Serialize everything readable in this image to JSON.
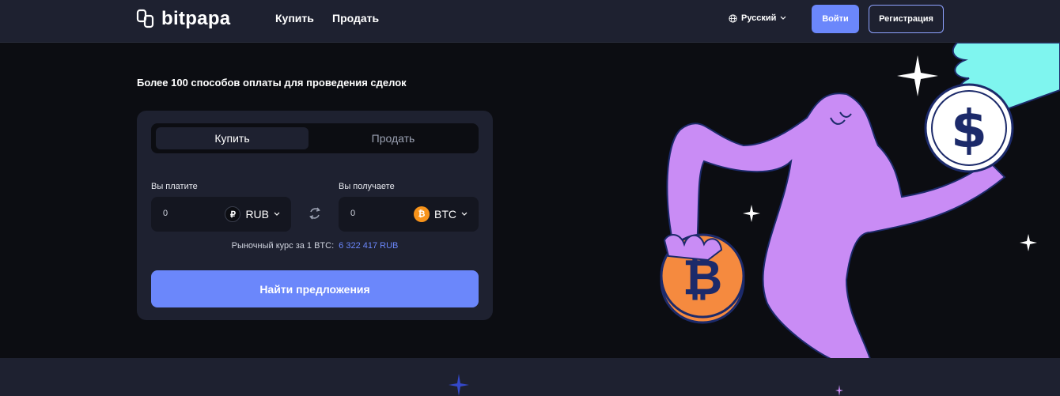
{
  "header": {
    "logo_text": "bitpapa",
    "nav": [
      "Купить",
      "Продать"
    ],
    "language": "Русский",
    "login": "Войти",
    "register": "Регистрация"
  },
  "hero": {
    "headline": "Более 100 способов оплаты для проведения сделок"
  },
  "exchange": {
    "tabs": [
      "Купить",
      "Продать"
    ],
    "active_tab": "Купить",
    "pay_label": "Вы платите",
    "pay_value": "0",
    "pay_currency": "RUB",
    "pay_symbol": "₽",
    "receive_label": "Вы получаете",
    "receive_value": "0",
    "receive_currency": "BTC",
    "receive_symbol": "₿",
    "rate_label": "Рыночный курс за 1 BTC:",
    "rate_value": "6 322 417 RUB",
    "find_button": "Найти предложения"
  },
  "colors": {
    "accent": "#6b87fb",
    "bg": "#0c0d12",
    "panel": "#1e2130",
    "bitcoin": "#f7931a",
    "character": "#c98cf5",
    "hand": "#7ff5ef"
  }
}
